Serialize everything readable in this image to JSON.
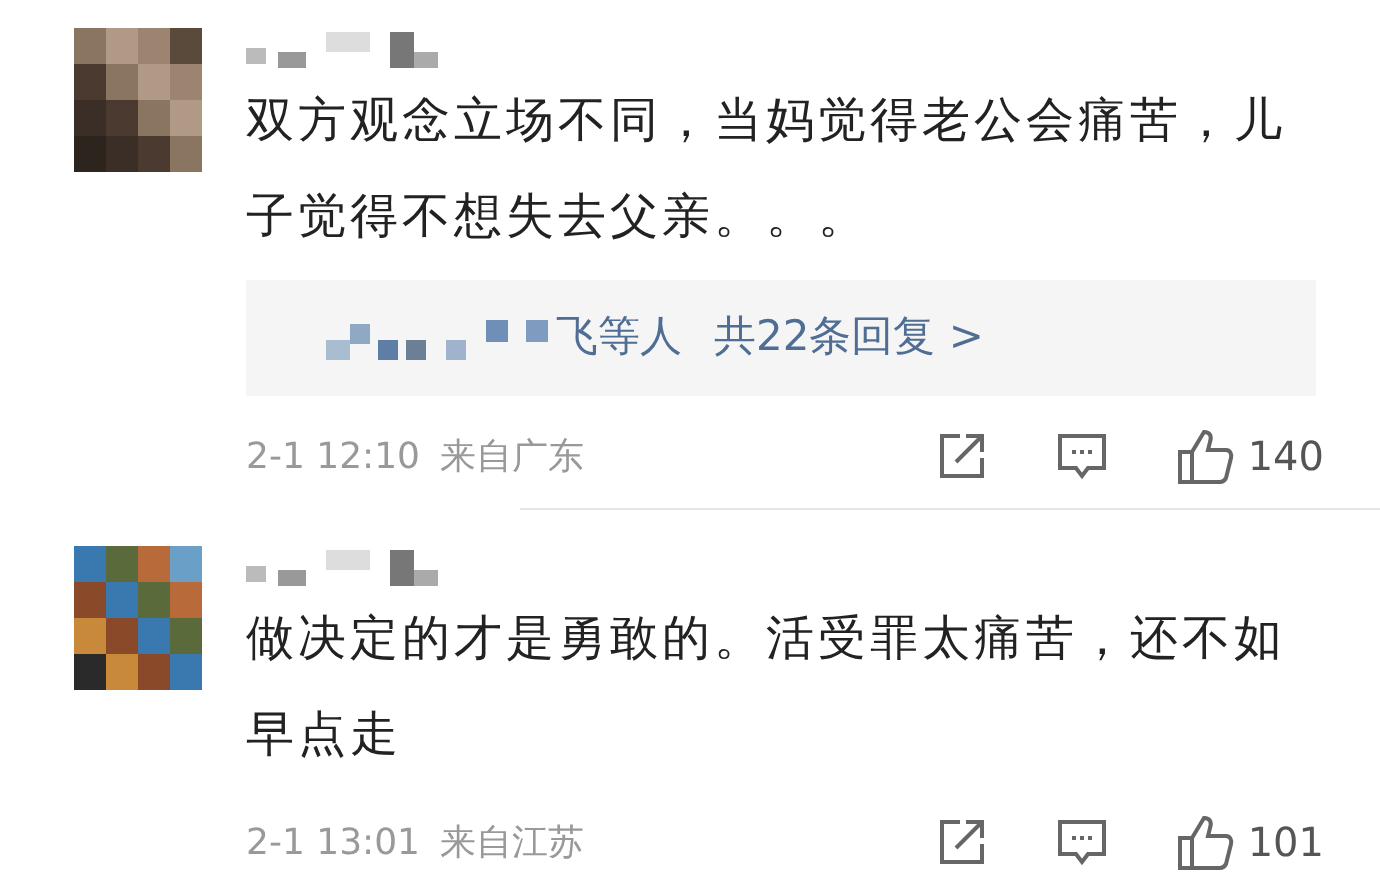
{
  "comments": [
    {
      "text": "双方观念立场不同，当妈觉得老公会痛苦，儿子觉得不想失去父亲。。。",
      "replies": {
        "names_tail": "飞等人",
        "count_text": "共22条回复 >"
      },
      "date": "2-1 12:10",
      "location": "来自广东",
      "likes": "140"
    },
    {
      "text": "做决定的才是勇敢的。活受罪太痛苦，还不如早点走",
      "date": "2-1 13:01",
      "location": "来自江苏",
      "likes": "101"
    }
  ]
}
